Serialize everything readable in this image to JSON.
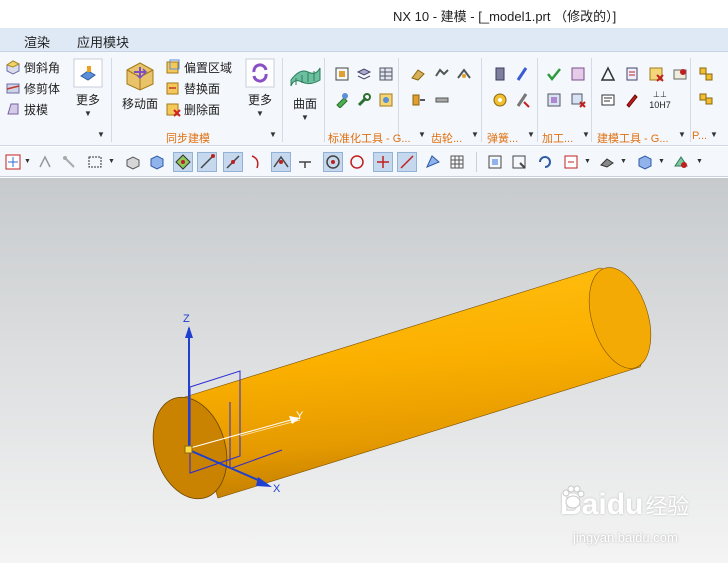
{
  "window": {
    "title": "NX 10 - 建模 - [_model1.prt （修改的）]"
  },
  "menu": {
    "items": [
      "渲染",
      "应用模块"
    ]
  },
  "ribbon": {
    "feature_small": [
      "倒斜角",
      "修剪体",
      "拔模"
    ],
    "more": "更多",
    "move_face": "移动面",
    "sync_small": [
      "偏置区域",
      "替换面",
      "删除面"
    ],
    "sync_more": "更多",
    "surface": "曲面",
    "groups": {
      "sync": "同步建模",
      "std": "标准化工具 - G...",
      "gear": "齿轮...",
      "spring": "弹簧...",
      "machining": "加工...",
      "model_tools": "建模工具 - G...",
      "p": "P..."
    },
    "fit_label": "10H7"
  },
  "viewport": {
    "axes": {
      "x": "X",
      "y": "Y",
      "z": "Z"
    },
    "colors": {
      "cylinder": "#f7a500",
      "cylinder_dark": "#c57e00",
      "triad_x": "#1f3fd0",
      "triad_z": "#1f3fd0",
      "csys": "#2a2ad8"
    }
  },
  "watermark": {
    "brand": "Bai",
    "brand2": "du",
    "product": "经验",
    "url": "jingyan.baidu.com"
  }
}
